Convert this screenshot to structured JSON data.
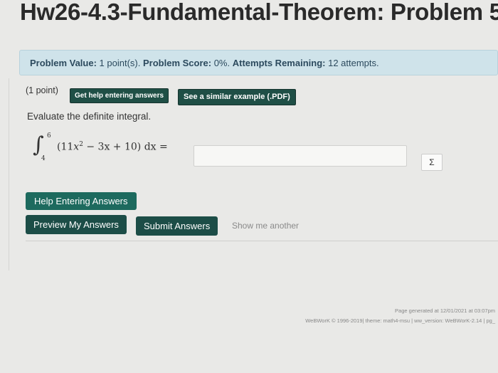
{
  "page": {
    "title": "Hw26-4.3-Fundamental-Theorem: Problem 5"
  },
  "problem_info": {
    "value_label": "Problem Value:",
    "value": "1 point(s).",
    "score_label": "Problem Score:",
    "score": "0%.",
    "attempts_label": "Attempts Remaining:",
    "attempts": "12 attempts."
  },
  "problem": {
    "points": "(1 point)",
    "hint_button": "Get help entering answers",
    "similar_button": "See a similar example (.PDF)",
    "prompt": "Evaluate the definite integral.",
    "integral": {
      "upper": "6",
      "lower": "4",
      "expression_open": "(11",
      "var": "x",
      "exp": "2",
      "rest": " − 3x + 10)  dx  ="
    },
    "answer_value": "",
    "sigma": "Σ"
  },
  "actions": {
    "help_label": "Help Entering Answers",
    "preview_label": "Preview My Answers",
    "submit_label": "Submit Answers",
    "show_another_label": "Show me another"
  },
  "footer": {
    "generated": "Page generated at 12/01/2021 at 03:07pm",
    "credits": "WeBWorK © 1996-2019| theme: math4-msu | ww_version: WeBWorK-2.14 | pg_"
  }
}
